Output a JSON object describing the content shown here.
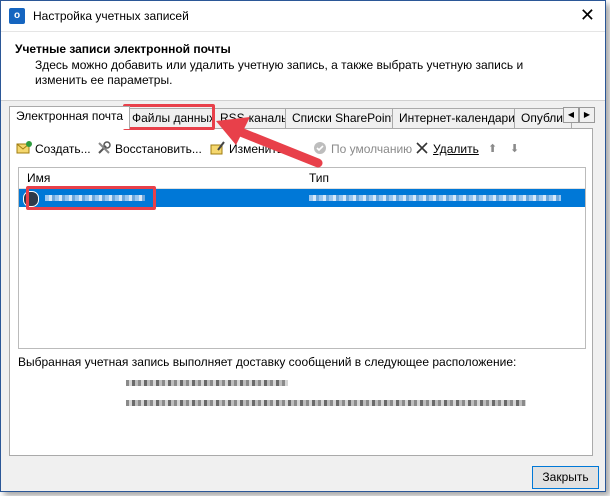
{
  "window": {
    "title": "Настройка учетных записей",
    "close_glyph": "✕"
  },
  "header": {
    "title": "Учетные записи электронной почты",
    "description": "Здесь можно добавить или удалить учетную запись, а также выбрать учетную запись и изменить ее параметры."
  },
  "tabs": [
    {
      "label": "Электронная почта",
      "active": true
    },
    {
      "label": "Файлы данных",
      "active": false
    },
    {
      "label": "RSS-каналы",
      "active": false
    },
    {
      "label": "Списки SharePoint",
      "active": false
    },
    {
      "label": "Интернет-календари",
      "active": false
    },
    {
      "label": "Опубликов",
      "active": false
    }
  ],
  "tab_scroll": {
    "left": "◀",
    "right": "▶"
  },
  "toolbar": {
    "create": "Создать...",
    "restore": "Восстановить...",
    "change": "Изменить...",
    "default": "По умолчанию",
    "delete": "Удалить",
    "up": "⬆",
    "down": "⬇"
  },
  "list": {
    "col_name": "Имя",
    "col_type": "Тип"
  },
  "delivery_text": "Выбранная учетная запись выполняет доставку сообщений в следующее расположение:",
  "footer": {
    "close_label": "Закрыть"
  },
  "colors": {
    "accent": "#0078d7",
    "highlight": "#e8404a"
  }
}
